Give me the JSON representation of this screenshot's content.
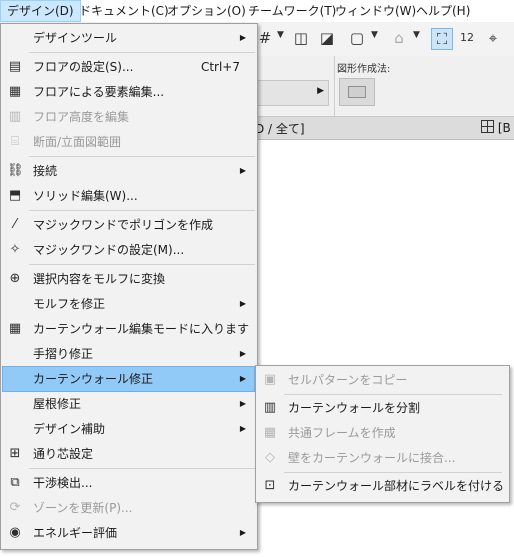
{
  "menubar": {
    "items": [
      {
        "label": "デザイン(D)"
      },
      {
        "label": "ドキュメント(C)"
      },
      {
        "label": "オプション(O)"
      },
      {
        "label": "チームワーク(T)"
      },
      {
        "label": "ウィンドウ(W)"
      },
      {
        "label": "ヘルプ(H)"
      }
    ]
  },
  "background": {
    "geometry_label": "図形作成法:",
    "tab_text": "D / 全て]",
    "tab2_label": "[B"
  },
  "design_menu": {
    "items": [
      {
        "label": "デザインツール",
        "icon": "none",
        "submenu": true
      },
      {
        "label": "フロアの設定(S)...",
        "icon": "floor-settings-icon",
        "shortcut": "Ctrl+7"
      },
      {
        "label": "フロアによる要素編集...",
        "icon": "floor-edit-icon"
      },
      {
        "label": "フロア高度を編集",
        "icon": "floor-height-icon",
        "disabled": true
      },
      {
        "label": "断面/立面図範囲",
        "icon": "section-range-icon",
        "disabled": true
      },
      {
        "label": "接続",
        "icon": "connect-icon",
        "submenu": true
      },
      {
        "label": "ソリッド編集(W)...",
        "icon": "solid-edit-icon"
      },
      {
        "label": "マジックワンドでポリゴンを作成",
        "icon": "magic-wand-icon"
      },
      {
        "label": "マジックワンドの設定(M)...",
        "icon": "magic-wand-settings-icon"
      },
      {
        "label": "選択内容をモルフに変換",
        "icon": "morph-convert-icon"
      },
      {
        "label": "モルフを修正",
        "icon": "none",
        "submenu": true
      },
      {
        "label": "カーテンウォール編集モードに入ります",
        "icon": "curtain-wall-edit-icon"
      },
      {
        "label": "手摺り修正",
        "icon": "none",
        "submenu": true
      },
      {
        "label": "カーテンウォール修正",
        "icon": "none",
        "submenu": true,
        "highlighted": true
      },
      {
        "label": "屋根修正",
        "icon": "none",
        "submenu": true
      },
      {
        "label": "デザイン補助",
        "icon": "none",
        "submenu": true
      },
      {
        "label": "通り芯設定",
        "icon": "grid-settings-icon"
      },
      {
        "label": "干渉検出...",
        "icon": "collision-detection-icon"
      },
      {
        "label": "ゾーンを更新(P)...",
        "icon": "zone-update-icon",
        "disabled": true
      },
      {
        "label": "エネルギー評価",
        "icon": "energy-evaluation-icon",
        "submenu": true
      }
    ]
  },
  "curtain_wall_submenu": {
    "items": [
      {
        "label": "セルパターンをコピー",
        "icon": "copy-pattern-icon",
        "disabled": true
      },
      {
        "label": "カーテンウォールを分割",
        "icon": "split-curtain-wall-icon"
      },
      {
        "label": "共通フレームを作成",
        "icon": "common-frame-icon",
        "disabled": true
      },
      {
        "label": "壁をカーテンウォールに接合...",
        "icon": "join-wall-icon",
        "disabled": true
      },
      {
        "label": "カーテンウォール部材にラベルを付ける",
        "icon": "label-members-icon"
      }
    ]
  },
  "colors": {
    "menu_background": "#f2f2f2",
    "highlight": "#91c9f7",
    "menubar_active": "#cce8ff",
    "disabled_text": "#9a9a9a"
  }
}
